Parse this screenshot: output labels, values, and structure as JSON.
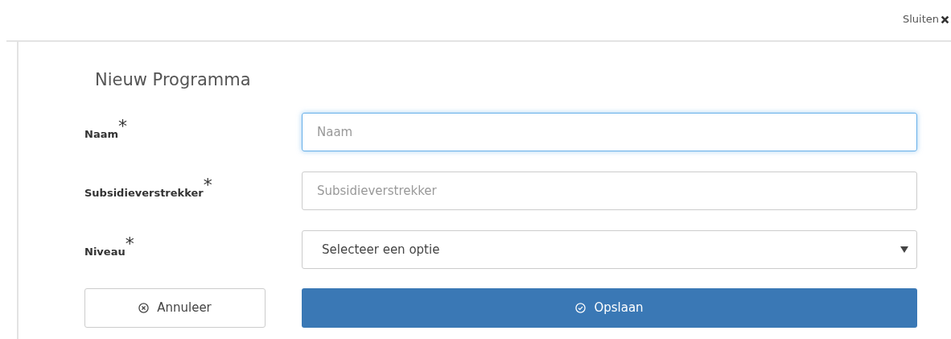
{
  "close_link": {
    "label": "Sluiten"
  },
  "form": {
    "title": "Nieuw Programma",
    "fields": [
      {
        "kind": "input",
        "label": "Naam$^{*}$",
        "placeholder": "Naam",
        "focused": true
      },
      {
        "kind": "input",
        "label": "Subsidieverstrekker$^{*}$",
        "placeholder": "Subsidieverstrekker",
        "focused": false
      },
      {
        "kind": "select",
        "label": "Niveau$^{*}$",
        "value": "Selecteer een optie",
        "focused": false
      }
    ],
    "buttons": [
      {
        "kind": "cancel",
        "label": "Annuleer"
      },
      {
        "kind": "save",
        "label": "Opslaan"
      }
    ]
  }
}
